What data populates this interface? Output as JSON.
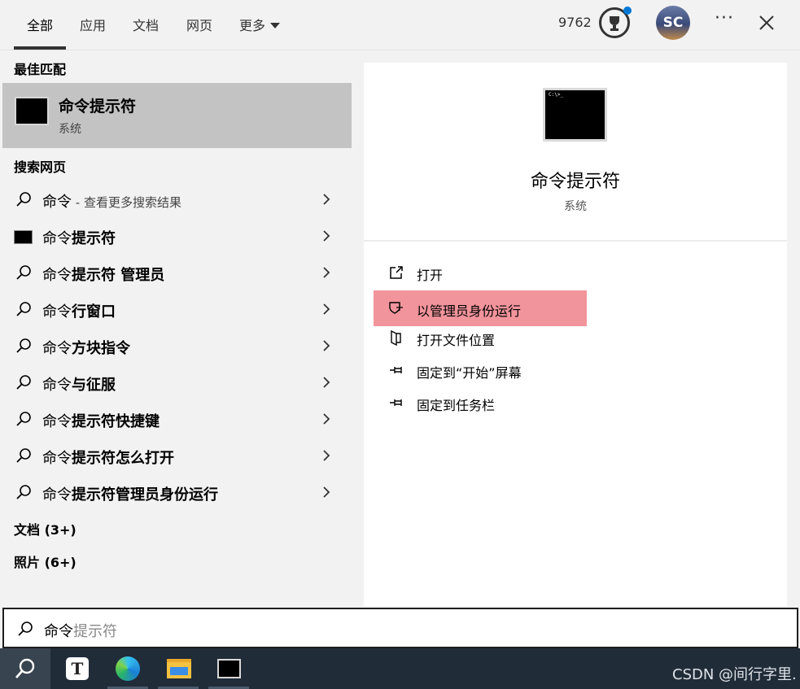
{
  "tabs": [
    {
      "label": "全部",
      "active": true
    },
    {
      "label": "应用"
    },
    {
      "label": "文档"
    },
    {
      "label": "网页"
    },
    {
      "label": "更多"
    }
  ],
  "header": {
    "points": "9762",
    "avatar_initials": "SC",
    "more": "···"
  },
  "best_match": {
    "heading": "最佳匹配",
    "title": "命令提示符",
    "subtitle": "系统",
    "icon": "cmd-icon"
  },
  "web": {
    "heading": "搜索网页",
    "items": [
      {
        "normal": "命令",
        "bold": "",
        "hint": " - 查看更多搜索结果",
        "icon": "search-icon"
      },
      {
        "normal": "命令",
        "bold": "提示符",
        "hint": "",
        "icon": "cmd-icon"
      },
      {
        "normal": "命令",
        "bold": "提示符 管理员",
        "hint": "",
        "icon": "search-icon"
      },
      {
        "normal": "命令",
        "bold": "行窗口",
        "hint": "",
        "icon": "search-icon"
      },
      {
        "normal": "命令",
        "bold": "方块指令",
        "hint": "",
        "icon": "search-icon"
      },
      {
        "normal": "命令",
        "bold": "与征服",
        "hint": "",
        "icon": "search-icon"
      },
      {
        "normal": "命令",
        "bold": "提示符快捷键",
        "hint": "",
        "icon": "search-icon"
      },
      {
        "normal": "命令",
        "bold": "提示符怎么打开",
        "hint": "",
        "icon": "search-icon"
      },
      {
        "normal": "命令",
        "bold": "提示符管理员身份运行",
        "hint": "",
        "icon": "search-icon"
      }
    ]
  },
  "docs_heading": "文档 (3+)",
  "photos_heading": "照片 (6+)",
  "preview": {
    "title": "命令提示符",
    "subtitle": "系统",
    "console_text": "C:\\>_",
    "actions": [
      {
        "label": "打开",
        "icon": "open-icon"
      },
      {
        "label": "以管理员身份运行",
        "icon": "shield-icon",
        "highlighted": true
      },
      {
        "label": "打开文件位置",
        "icon": "file-location-icon"
      },
      {
        "label": "固定到“开始”屏幕",
        "icon": "pin-icon"
      },
      {
        "label": "固定到任务栏",
        "icon": "pin-icon"
      }
    ]
  },
  "search": {
    "typed": "命令",
    "suggestion": "提示符"
  },
  "taskbar": {
    "apps": [
      "search-icon",
      "typora-icon",
      "edge-icon",
      "file-explorer-icon",
      "cmd-icon"
    ],
    "typora_letter": "T",
    "watermark": "CSDN @间行字里."
  },
  "colors": {
    "highlight": "#f2949b",
    "best_match_bg": "#c3c3c3",
    "taskbar": "#212c39",
    "accent": "#0078d4"
  }
}
